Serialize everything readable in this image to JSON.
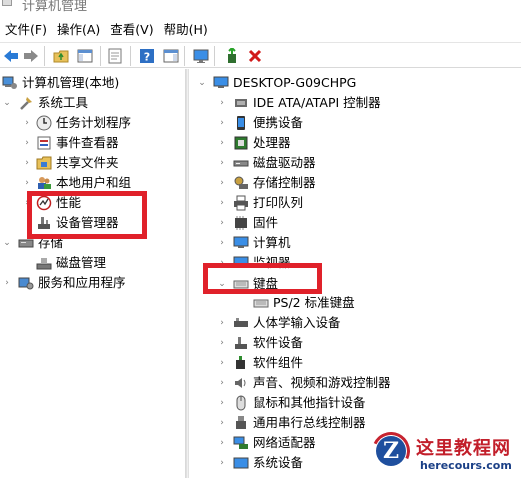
{
  "window": {
    "title": "计算机管理"
  },
  "menubar": {
    "items": [
      "文件(F)",
      "操作(A)",
      "查看(V)",
      "帮助(H)"
    ]
  },
  "toolbar": {
    "buttons": [
      "back-arrow-icon",
      "forward-arrow-icon",
      "up-folder-icon",
      "show-hide-tree-icon",
      "properties-icon",
      "help-icon",
      "show-hide-action-pane-icon",
      "monitor-icon",
      "update-driver-icon",
      "uninstall-x-icon"
    ]
  },
  "left_tree": {
    "root": "计算机管理(本地)",
    "system_tools": "系统工具",
    "task_scheduler": "任务计划程序",
    "event_viewer": "事件查看器",
    "shared_folders": "共享文件夹",
    "local_users": "本地用户和组",
    "performance": "性能",
    "device_manager": "设备管理器",
    "storage": "存储",
    "disk_management": "磁盘管理",
    "services_apps": "服务和应用程序"
  },
  "right_tree": {
    "computer": "DESKTOP-G09CHPG",
    "items": [
      "IDE ATA/ATAPI 控制器",
      "便携设备",
      "处理器",
      "磁盘驱动器",
      "存储控制器",
      "打印队列",
      "固件",
      "计算机",
      "监视器",
      "键盘",
      "PS/2 标准键盘",
      "人体学输入设备",
      "软件设备",
      "软件组件",
      "声音、视频和游戏控制器",
      "鼠标和其他指针设备",
      "通用串行总线控制器",
      "网络适配器",
      "系统设备"
    ]
  },
  "watermark": {
    "title": "这里教程网",
    "url": "herecours.com",
    "logo_letter": "Z"
  },
  "colors": {
    "highlight_box": "#e0212a",
    "watermark_red": "#c21e2a",
    "watermark_blue": "#1a3f86"
  }
}
